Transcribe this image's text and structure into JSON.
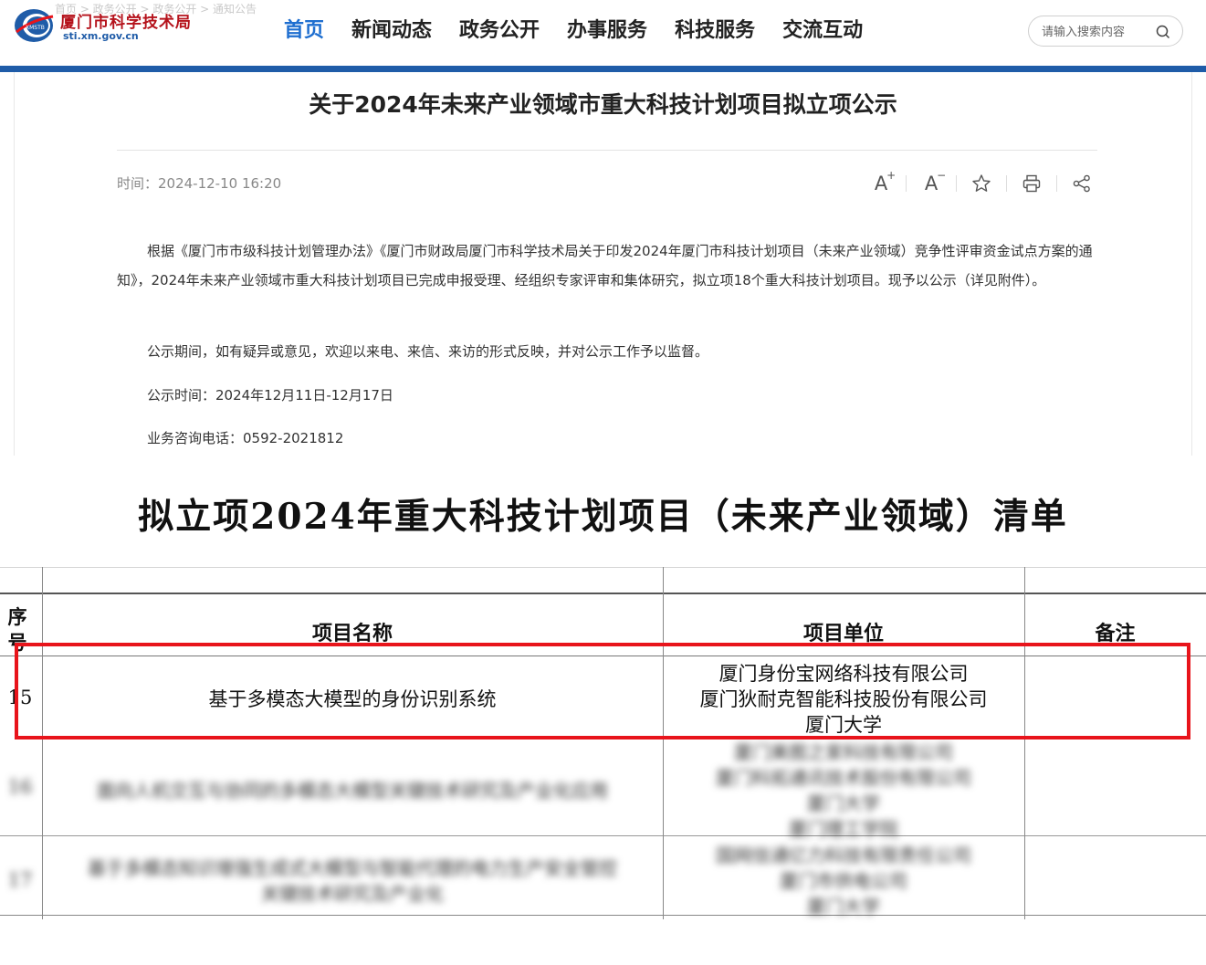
{
  "header": {
    "breadcrumb_ghost": "首页 > 政务公开 > 政务公开 > 通知公告",
    "logo_title": "厦门市科学技术局",
    "logo_sub": "sti.xm.gov.cn",
    "logo_mark_text": "XMSTB",
    "nav": [
      {
        "label": "首页",
        "active": true
      },
      {
        "label": "新闻动态",
        "active": false
      },
      {
        "label": "政务公开",
        "active": false
      },
      {
        "label": "办事服务",
        "active": false
      },
      {
        "label": "科技服务",
        "active": false
      },
      {
        "label": "交流互动",
        "active": false
      }
    ],
    "search_placeholder": "请输入搜索内容",
    "accent_color": "#1f5ca8",
    "logo_color": "#b5121b"
  },
  "article": {
    "title": "关于2024年未来产业领域市重大科技计划项目拟立项公示",
    "time": "时间：2024-12-10 16:20",
    "tools": {
      "font_larger": "A",
      "font_larger_sup": "+",
      "font_smaller": "A",
      "font_smaller_sup": "−",
      "icons": [
        "font-increase-icon",
        "font-decrease-icon",
        "star-icon",
        "print-icon",
        "share-icon"
      ]
    },
    "paragraphs": [
      "根据《厦门市市级科技计划管理办法》《厦门市财政局厦门市科学技术局关于印发2024年厦门市科技计划项目（未来产业领域）竞争性评审资金试点方案的通知》，2024年未来产业领域市重大科技计划项目已完成申报受理、经组织专家评审和集体研究，拟立项18个重大科技计划项目。现予以公示（详见附件）。",
      "公示期间，如有疑异或意见，欢迎以来电、来信、来访的形式反映，并对公示工作予以监督。",
      "公示时间：2024年12月11日-12月17日",
      "业务咨询电话：0592-2021812"
    ]
  },
  "document": {
    "title": "拟立项2024年重大科技计划项目（未来产业领域）清单",
    "columns": [
      "序号",
      "项目名称",
      "项目单位",
      "备注"
    ],
    "highlighted_row": {
      "index": "15",
      "name": "基于多模态大模型的身份识别系统",
      "units": [
        "厦门身份宝网络科技有限公司",
        "厦门狄耐克智能科技股份有限公司",
        "厦门大学"
      ],
      "note": ""
    },
    "blurred_rows": [
      {
        "index": "16",
        "name": "面向人机交互与协同的多模态大模型关键技术研究及产业化应用",
        "units": [
          "厦门美图之家科技有限公司",
          "厦门科拓通讯技术股份有限公司",
          "厦门大学",
          "厦门理工学院"
        ]
      },
      {
        "index": "17",
        "name_lines": [
          "基于多模态知识增强生成式大模型与智能代理的电力生产安全管控",
          "关键技术研究及产业化"
        ],
        "units": [
          "国网信通亿力科技有限责任公司",
          "厦门市供电公司",
          "厦门大学"
        ]
      }
    ],
    "highlight_color": "#e8141b"
  }
}
